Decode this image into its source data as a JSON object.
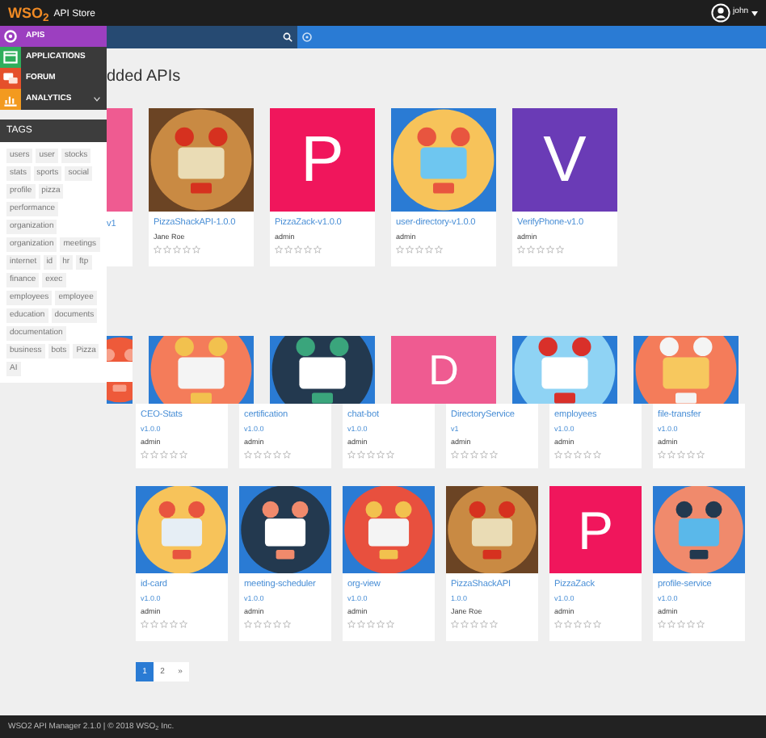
{
  "header": {
    "logo": "WSO$_{2}$",
    "title": "API Store",
    "user": "john"
  },
  "menu": [
    {
      "label": "APIS",
      "kind": "apis",
      "selected": true,
      "has_submenu": false
    },
    {
      "label": "APPLICATIONS",
      "kind": "applications",
      "selected": false,
      "has_submenu": false
    },
    {
      "label": "FORUM",
      "kind": "forum",
      "selected": false,
      "has_submenu": false
    },
    {
      "label": "ANALYTICS",
      "kind": "analytics",
      "selected": false,
      "has_submenu": true
    }
  ],
  "tags_title": "TAGS",
  "tags": [
    "users",
    "user",
    "stocks",
    "stats",
    "sports",
    "social",
    "profile",
    "pizza",
    "performance",
    "organization",
    "organization",
    "meetings",
    "internet",
    "id",
    "hr",
    "ftp",
    "finance",
    "exec",
    "employees",
    "employee",
    "education",
    "documents",
    "documentation",
    "business",
    "bots",
    "Pizza",
    "AI"
  ],
  "heading": "dded APIs",
  "recent_partial_text": "v1",
  "recent": [
    {
      "title": "PizzaShackAPI-1.0.0",
      "author": "Jane Roe",
      "stars": 0,
      "thumb": {
        "kind": "picture"
      }
    },
    {
      "title": "PizzaZack-v1.0.0",
      "author": "admin",
      "stars": 0,
      "thumb": {
        "kind": "letter",
        "letter": "P",
        "color": "#f0165c"
      }
    },
    {
      "title": "user-directory-v1.0.0",
      "author": "admin",
      "stars": 0,
      "thumb": {
        "kind": "picture"
      }
    },
    {
      "title": "VerifyPhone-v1.0",
      "author": "admin",
      "stars": 0,
      "thumb": {
        "kind": "letter",
        "letter": "V",
        "color": "#6a3bb6"
      }
    }
  ],
  "all_thumbs": [
    {
      "kind": "picture",
      "partial": true
    },
    {
      "kind": "picture",
      "partial": false
    },
    {
      "kind": "picture",
      "partial": false
    },
    {
      "kind": "letter",
      "letter": "D",
      "color": "#ef5b91",
      "partial": false
    },
    {
      "kind": "picture",
      "partial": false
    },
    {
      "kind": "picture",
      "partial": false
    }
  ],
  "all_cards": [
    {
      "title": "CEO-Stats",
      "version": "v1.0.0",
      "author": "admin",
      "stars": 0
    },
    {
      "title": "certification",
      "version": "v1.0.0",
      "author": "admin",
      "stars": 0
    },
    {
      "title": "chat-bot",
      "version": "v1.0.0",
      "author": "admin",
      "stars": 0
    },
    {
      "title": "DirectoryService",
      "version": "v1",
      "author": "admin",
      "stars": 0
    },
    {
      "title": "employees",
      "version": "v1.0.0",
      "author": "admin",
      "stars": 0
    },
    {
      "title": "file-transfer",
      "version": "v1.0.0",
      "author": "admin",
      "stars": 0
    }
  ],
  "more_cards": [
    {
      "title": "id-card",
      "version": "v1.0.0",
      "author": "admin",
      "stars": 0,
      "thumb": {
        "kind": "picture"
      }
    },
    {
      "title": "meeting-scheduler",
      "version": "v1.0.0",
      "author": "admin",
      "stars": 0,
      "thumb": {
        "kind": "picture"
      }
    },
    {
      "title": "org-view",
      "version": "v1.0.0",
      "author": "admin",
      "stars": 0,
      "thumb": {
        "kind": "picture"
      }
    },
    {
      "title": "PizzaShackAPI",
      "version": "1.0.0",
      "author": "Jane Roe",
      "stars": 0,
      "thumb": {
        "kind": "picture"
      }
    },
    {
      "title": "PizzaZack",
      "version": "v1.0.0",
      "author": "admin",
      "stars": 0,
      "thumb": {
        "kind": "letter",
        "letter": "P",
        "color": "#f0165c"
      }
    },
    {
      "title": "profile-service",
      "version": "v1.0.0",
      "author": "admin",
      "stars": 0,
      "thumb": {
        "kind": "picture"
      }
    }
  ],
  "pages": [
    {
      "label": "1",
      "selected": true
    },
    {
      "label": "2",
      "selected": false
    },
    {
      "label": "»",
      "selected": false
    }
  ],
  "footer": "WSO2 API Manager 2.1.0 | © 2018 WSO$_{2}$ Inc."
}
